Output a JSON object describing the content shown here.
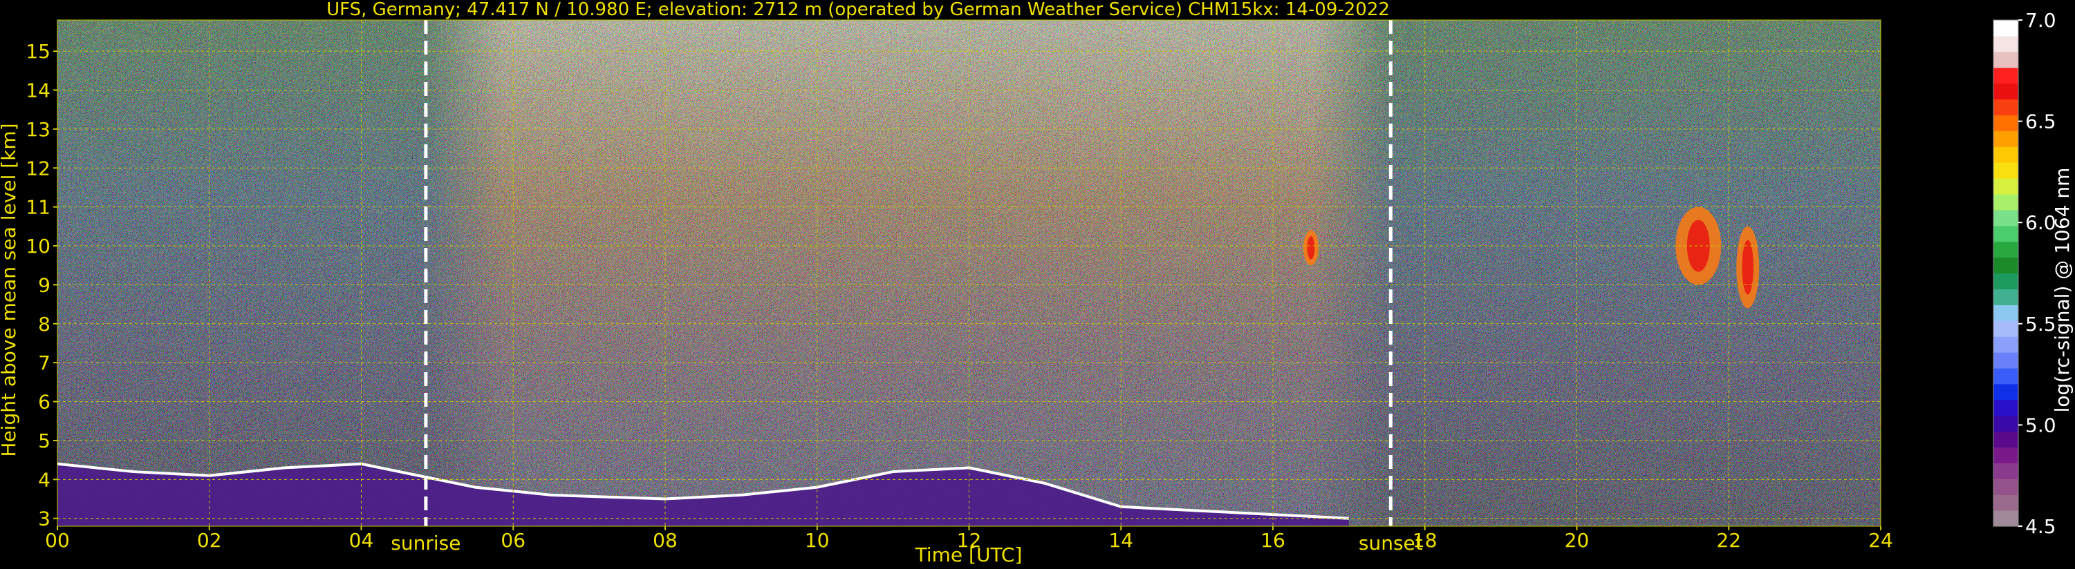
{
  "chart_data": {
    "type": "heatmap",
    "title": "UFS, Germany; 47.417 N / 10.980 E; elevation: 2712 m  (operated by German Weather Service)     CHM15kx: 14-09-2022",
    "xlabel": "Time [UTC]",
    "ylabel": "Height above mean sea level [km]",
    "xlim": [
      0,
      24
    ],
    "ylim": [
      2.8,
      15.8
    ],
    "x_ticks": [
      0,
      2,
      4,
      6,
      8,
      10,
      12,
      14,
      16,
      18,
      20,
      22,
      24
    ],
    "x_tick_labels": [
      "00",
      "02",
      "04",
      "06",
      "08",
      "10",
      "12",
      "14",
      "16",
      "18",
      "20",
      "22",
      "24"
    ],
    "y_ticks": [
      3,
      4,
      5,
      6,
      7,
      8,
      9,
      10,
      11,
      12,
      13,
      14,
      15
    ],
    "y_tick_labels": [
      "3",
      "4",
      "5",
      "6",
      "7",
      "8",
      "9",
      "10",
      "11",
      "12",
      "13",
      "14",
      "15"
    ],
    "grid": true,
    "annotations": [
      {
        "label": "sunrise",
        "x": 4.85
      },
      {
        "label": "sunset",
        "x": 17.55
      }
    ],
    "colorbar": {
      "label": "log(rc-signal) @ 1064 nm",
      "range": [
        4.5,
        7.0
      ],
      "ticks": [
        4.5,
        5.0,
        5.5,
        6.0,
        6.5,
        7.0
      ],
      "tick_labels": [
        "4.5",
        "5.0",
        "5.5",
        "6.0",
        "6.5",
        "7.0"
      ],
      "colors": [
        "#a08a9a",
        "#9a6a8c",
        "#94528a",
        "#8a3a8c",
        "#7a1a8a",
        "#5a0a8a",
        "#3a0aa8",
        "#2a10c8",
        "#1030e8",
        "#3a5cf8",
        "#6a80f8",
        "#8aa0fa",
        "#a6bcfa",
        "#8ac8f0",
        "#40b090",
        "#1c9a60",
        "#1a8a2a",
        "#2aa840",
        "#4acd6a",
        "#7ae08a",
        "#a8f06a",
        "#d8f040",
        "#f8e010",
        "#ffc800",
        "#ffa000",
        "#ff7000",
        "#f84010",
        "#e81010",
        "#ff2020",
        "#e8c0c0",
        "#f4e4e4",
        "#ffffff"
      ]
    },
    "features": {
      "boundary_layer_top_km": [
        {
          "x": 0.0,
          "y": 4.4
        },
        {
          "x": 1.0,
          "y": 4.2
        },
        {
          "x": 2.0,
          "y": 4.1
        },
        {
          "x": 3.0,
          "y": 4.3
        },
        {
          "x": 4.0,
          "y": 4.4
        },
        {
          "x": 5.5,
          "y": 3.8
        },
        {
          "x": 6.5,
          "y": 3.6
        },
        {
          "x": 8.0,
          "y": 3.5
        },
        {
          "x": 9.0,
          "y": 3.6
        },
        {
          "x": 10.0,
          "y": 3.8
        },
        {
          "x": 11.0,
          "y": 4.2
        },
        {
          "x": 12.0,
          "y": 4.3
        },
        {
          "x": 13.0,
          "y": 3.9
        },
        {
          "x": 14.0,
          "y": 3.3
        },
        {
          "x": 15.0,
          "y": 3.2
        },
        {
          "x": 16.0,
          "y": 3.1
        },
        {
          "x": 17.0,
          "y": 3.0
        }
      ],
      "high_clouds": [
        {
          "x0": 21.3,
          "x1": 21.9,
          "y0": 9.0,
          "y1": 11.0
        },
        {
          "x0": 22.1,
          "x1": 22.4,
          "y0": 8.4,
          "y1": 10.5
        },
        {
          "x0": 16.4,
          "x1": 16.6,
          "y0": 9.5,
          "y1": 10.4
        }
      ]
    }
  }
}
